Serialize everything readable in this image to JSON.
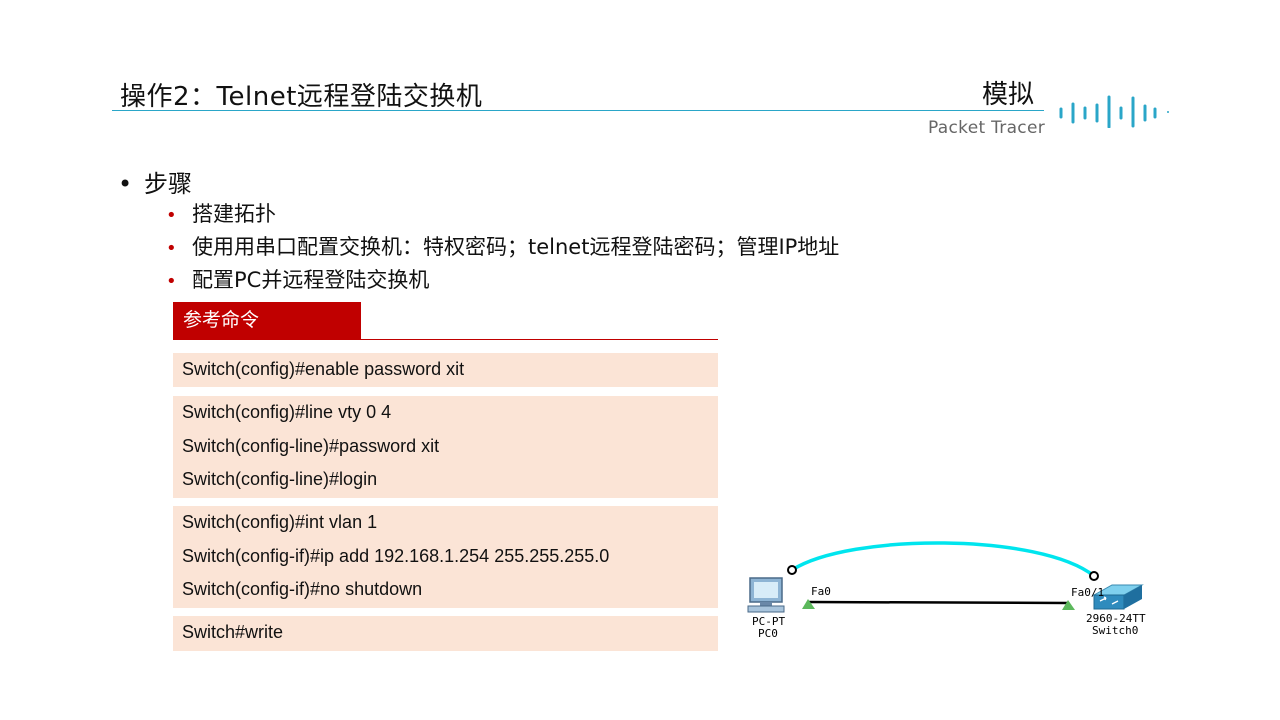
{
  "header": {
    "title": "操作2：Telnet远程登陆交换机",
    "mode": "模拟",
    "subtitle": "Packet Tracer",
    "accent_color": "#2aa6c8"
  },
  "steps": {
    "heading": "步骤",
    "items": [
      "搭建拓扑",
      "使用用串口配置交换机：特权密码；telnet远程登陆密码；管理IP地址",
      "配置PC并远程登陆交换机"
    ]
  },
  "reference": {
    "heading": "参考命令",
    "header_color": "#c00000",
    "block_color": "#fbe4d6",
    "blocks": [
      [
        "Switch(config)#enable  password  xit"
      ],
      [
        "Switch(config)#line vty 0 4",
        "Switch(config-line)#password  xit",
        "Switch(config-line)#login"
      ],
      [
        "Switch(config)#int vlan 1",
        "Switch(config-if)#ip add 192.168.1.254 255.255.255.0",
        "Switch(config-if)#no shutdown"
      ],
      [
        "Switch#write"
      ]
    ]
  },
  "topology": {
    "pc": {
      "port": "Fa0",
      "model": "PC-PT",
      "name": "PC0"
    },
    "switch": {
      "port": "Fa0/1",
      "model": "2960-24TT",
      "name": "Switch0"
    },
    "link_color": "#00e5ee",
    "link_status_color": "#5cb85c"
  }
}
